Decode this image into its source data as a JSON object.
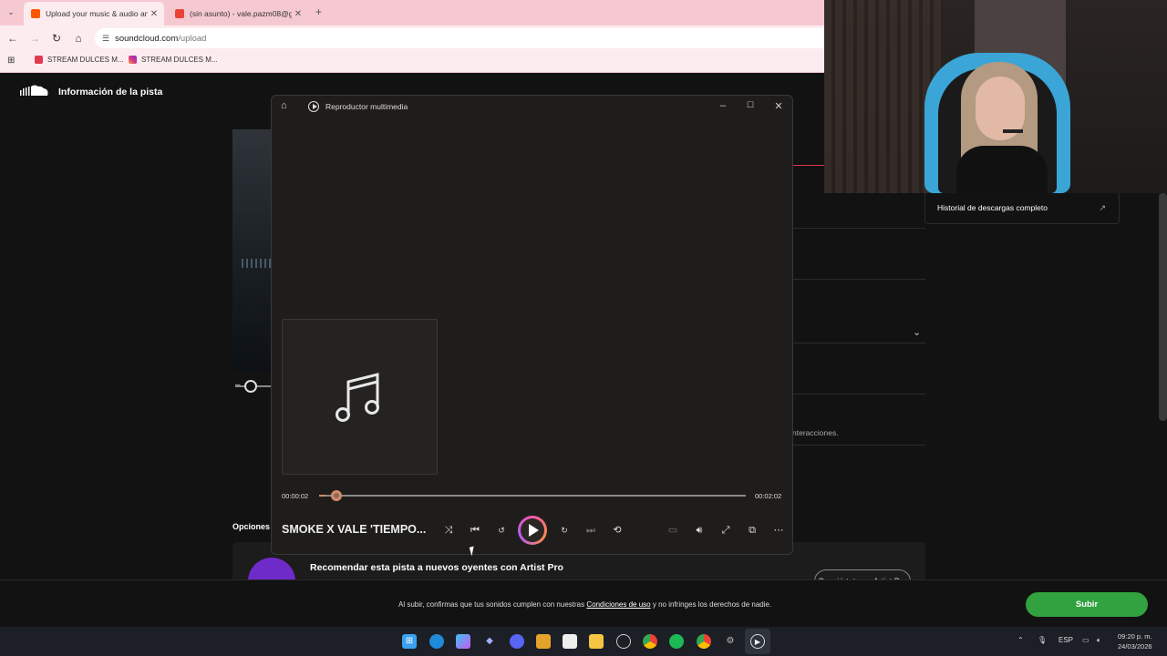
{
  "browser": {
    "tabs": [
      {
        "title": "Upload your music & audio an",
        "active": true,
        "icon": "soundcloud-icon",
        "color": "#ff5500"
      },
      {
        "title": "(sin asunto) - vale.pazm08@gm",
        "active": false,
        "icon": "gmail-icon",
        "color": "#ea4335"
      }
    ],
    "new_tab": "+",
    "url_host": "soundcloud.com",
    "url_path": "/upload",
    "bookmarks": [
      {
        "label": "STREAM DULCES M...",
        "icon": "youtube-icon"
      },
      {
        "label": "STREAM DULCES M...",
        "icon": "instagram-icon"
      }
    ]
  },
  "soundcloud": {
    "header_title": "Información de la pista",
    "history_label": "Historial de descargas completo",
    "interactions_text": "nteracciones.",
    "options_label": "Opciones",
    "recommend_title": "Recomendar esta pista a nuevos oyentes con Artist Pro",
    "recommend_button": "Conviértete en Artist Pro",
    "footer_prefix": "Al subir, confirmas que tus sonidos cumplen con nuestras",
    "footer_link": "Condiciones de uso",
    "footer_suffix": "y no infringes los derechos de nadie.",
    "submit_label": "Subir",
    "accent": "#31a23f"
  },
  "player": {
    "app_name": "Reproductor multimedia",
    "time_current": "00:00:02",
    "time_total": "00:02:02",
    "progress": 0.016,
    "song_title": "SMOKE X VALE 'TIEMPO...",
    "accent": "#d38b6a"
  },
  "taskbar": {
    "language": "ESP",
    "time": "09:20 p. m.",
    "date": "24/03/2026"
  }
}
